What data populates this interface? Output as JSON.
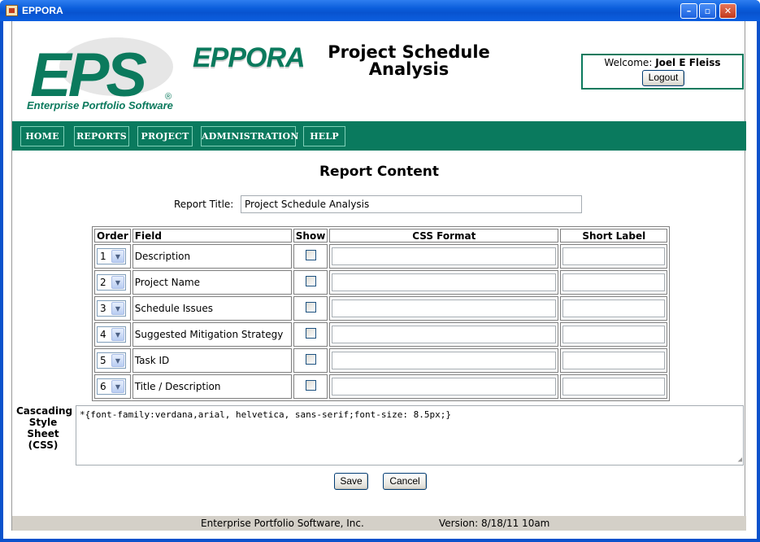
{
  "window": {
    "title": "EPPORA",
    "controls": {
      "minimize": "–",
      "maximize": "▫",
      "close": "✕"
    }
  },
  "header": {
    "eps_logo_text": "EPS",
    "eps_tagline": "Enterprise Portfolio Software",
    "registered_mark": "®",
    "eppora_logo_text": "EPPORA",
    "page_title_line1": "Project Schedule",
    "page_title_line2": "Analysis",
    "welcome_prefix": "Welcome:",
    "welcome_user": "Joel E Fleiss",
    "logout_label": "Logout"
  },
  "nav": {
    "items": [
      {
        "label": "HOME"
      },
      {
        "label": "REPORTS"
      },
      {
        "label": "PROJECT"
      },
      {
        "label": "ADMINISTRATION"
      },
      {
        "label": "HELP"
      }
    ]
  },
  "main": {
    "section_title": "Report Content",
    "report_title_label": "Report Title:",
    "report_title_value": "Project Schedule Analysis",
    "columns": {
      "order": "Order",
      "field": "Field",
      "show": "Show",
      "css_format": "CSS Format",
      "short_label": "Short Label"
    },
    "rows": [
      {
        "order": "1",
        "field": "Description",
        "show": false,
        "css_format": "",
        "short_label": ""
      },
      {
        "order": "2",
        "field": "Project Name",
        "show": false,
        "css_format": "",
        "short_label": ""
      },
      {
        "order": "3",
        "field": "Schedule Issues",
        "show": false,
        "css_format": "",
        "short_label": ""
      },
      {
        "order": "4",
        "field": "Suggested Mitigation Strategy",
        "show": false,
        "css_format": "",
        "short_label": ""
      },
      {
        "order": "5",
        "field": "Task ID",
        "show": false,
        "css_format": "",
        "short_label": ""
      },
      {
        "order": "6",
        "field": "Title / Description",
        "show": false,
        "css_format": "",
        "short_label": ""
      }
    ],
    "css_label_lines": [
      "Cascading",
      "Style",
      "Sheet",
      "(CSS)"
    ],
    "css_value": "*{font-family:verdana,arial, helvetica, sans-serif;font-size: 8.5px;}",
    "save_label": "Save",
    "cancel_label": "Cancel"
  },
  "footer": {
    "company": "Enterprise Portfolio Software, Inc.",
    "version": "Version: 8/18/11 10am"
  },
  "colors": {
    "brand_green": "#0a7a5e",
    "titlebar_blue": "#0a5ddb",
    "footer_gray": "#d4d0c8"
  }
}
